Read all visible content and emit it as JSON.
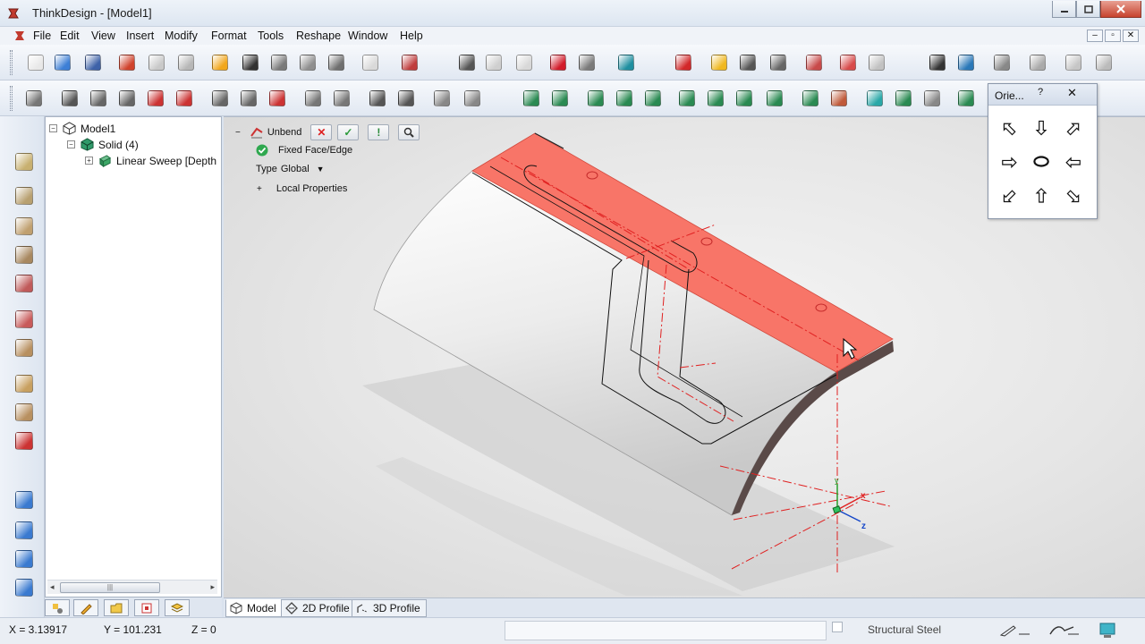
{
  "window": {
    "title": "ThinkDesign  - [Model1]",
    "buttons": [
      "minimize",
      "restore",
      "close"
    ]
  },
  "menu": {
    "items": [
      "File",
      "Edit",
      "View",
      "Insert",
      "Modify",
      "Format",
      "Tools",
      "Reshape",
      "Window",
      "Help"
    ]
  },
  "toolbar_row1": {
    "icons": [
      "new-icon",
      "open-icon",
      "save-icon",
      "undo-icon",
      "redo-icon",
      "split-icon",
      "shaded-box-icon",
      "sphere-icon",
      "zoom-icon",
      "cube-view-icon",
      "measure-icon",
      "table-icon",
      "help-icon",
      "select-icon",
      "select-faces-icon",
      "select-solid-icon",
      "red-polyhedron-icon",
      "mesh-icon",
      "curve-tool-icon",
      "delete-icon",
      "sparkle-icon",
      "trim-icon",
      "fix-icon",
      "shape-icon",
      "copy-icon",
      "transform-icon",
      "plane-icon",
      "dimension-icon",
      "snap-icon",
      "width-icon",
      "layers-icon",
      "layer-group-icon"
    ]
  },
  "toolbar_row2": {
    "icons": [
      "spline-icon",
      "line-icon",
      "parallel-icon",
      "angle-icon",
      "bisector-icon",
      "crosshair-icon",
      "circle-center-icon",
      "circle-icon",
      "arc-icon",
      "ellipse-icon",
      "free-curve-icon",
      "rectangle-icon",
      "polygon-icon",
      "fillet-icon",
      "chamfer-icon",
      "extrude-icon",
      "revolve-icon",
      "hole-icon",
      "shell-icon",
      "draft-icon",
      "box-icon",
      "prism-icon",
      "wedge-icon",
      "cluster-icon",
      "boolean-icon",
      "pocket-icon",
      "cylinder-icon",
      "stack-icon",
      "compound-icon",
      "explode-icon"
    ]
  },
  "left_toolbar": {
    "icons": [
      "sheet-icon",
      "bend-icon",
      "flange-icon",
      "unfold-icon",
      "rip-icon",
      "unbend-icon",
      "rebend-icon",
      "columns-icon",
      "crate-icon",
      "axes-icon",
      "param-icon",
      "route-icon",
      "edit-part-icon",
      "export-icon"
    ]
  },
  "tree": {
    "root": "Model1",
    "solid": "Solid (4)",
    "feature": "Linear Sweep [Depth"
  },
  "tree_tabs": [
    "tree-tab-icon",
    "sketch-tab-icon",
    "folder-tab-icon",
    "stamp-tab-icon",
    "layers-tab-icon"
  ],
  "command": {
    "name": "Unbend",
    "fixed_label": "Fixed Face/Edge",
    "type_label": "Type",
    "type_value": "Global",
    "local_props": "Local Properties"
  },
  "orientation": {
    "title": "Orie...",
    "help": "?",
    "close": "✕"
  },
  "view_tabs": [
    "Model",
    "2D Profile",
    "3D Profile"
  ],
  "status": {
    "x": "X = 3.13917",
    "y": "Y = 101.231",
    "z": "Z = 0",
    "material": "Structural Steel"
  },
  "colors": {
    "selected_face": "#f87568",
    "axis_red": "#e02020",
    "axis_green": "#1a9a20",
    "axis_blue": "#1446c8",
    "chrome_bg": "#d9e2ee"
  }
}
